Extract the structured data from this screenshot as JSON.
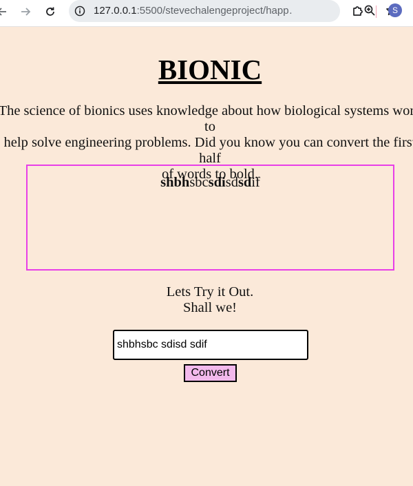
{
  "browser": {
    "url_host": "127.0.0.1",
    "url_rest": ":5500/stevechalengeproject/happ…",
    "avatar_letter": "S",
    "icons": [
      "back-arrow-icon",
      "forward-arrow-icon",
      "reload-icon",
      "site-info-icon",
      "zoom-icon",
      "star-icon",
      "extensions-icon"
    ]
  },
  "page": {
    "title": "BIONIC",
    "intro_line1": "The science of bionics uses knowledge about how biological systems work to",
    "intro_line2": "help solve engineering problems. Did you know you can convert the first half",
    "intro_line3": "of words to bold.",
    "output": {
      "words": [
        {
          "bold": "shbh",
          "rest": "sbc"
        },
        {
          "bold": "sdi",
          "rest": "sd"
        },
        {
          "bold": "sd",
          "rest": "if"
        }
      ]
    },
    "prompt_line1": "Lets Try it Out.",
    "prompt_line2": "Shall we!",
    "input_value": "shbhsbc sdisd sdif",
    "convert_label": "Convert"
  },
  "colors": {
    "background": "#fbe9d9",
    "output_border": "#e83ee8",
    "button_bg": "#f2b9ec"
  }
}
